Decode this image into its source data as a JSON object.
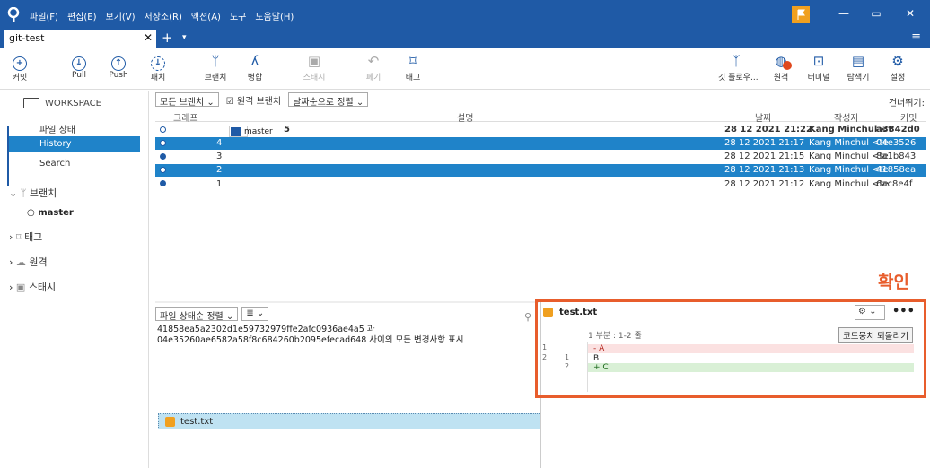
{
  "titlebar": {
    "menu": [
      "파일(F)",
      "편집(E)",
      "보기(V)",
      "저장소(R)",
      "액션(A)",
      "도구",
      "도움말(H)"
    ],
    "min": "—",
    "max": "▭",
    "close": "✕"
  },
  "tab": {
    "label": "git-test",
    "close": "✕",
    "plus": "+",
    "dropdown": "▾",
    "menu": "≡"
  },
  "toolbar": {
    "commit": "커밋",
    "pull": "Pull",
    "push": "Push",
    "patch": "패치",
    "branch": "브랜치",
    "merge": "병합",
    "stash": "스태시",
    "discard": "폐기",
    "tag": "태그",
    "gitflow": "깃 플로우...",
    "remote": "원격",
    "terminal": "터미널",
    "explorer": "탐색기",
    "settings": "설정"
  },
  "sidebar": {
    "workspace": "WORKSPACE",
    "items": [
      "파일 상태",
      "History",
      "Search"
    ],
    "branches": "브랜치",
    "master": "master",
    "tags": "태그",
    "remotes": "원격",
    "stash": "스태시"
  },
  "commits": {
    "filters": [
      "모든 브랜치 ⌄",
      "원격 브랜치",
      "날짜순으로 정렬 ⌄"
    ],
    "skip": "건너뛰기:",
    "headers": [
      "그래프",
      "설명",
      "날짜",
      "작성자",
      "커밋"
    ],
    "rows": [
      {
        "desc": "5",
        "date": "28 12 2021 21:22",
        "author": "Kang Minchul <t",
        "hash": "a3342d0"
      },
      {
        "desc": "4",
        "date": "28 12 2021 21:17",
        "author": "Kang Minchul <te",
        "hash": "04e3526"
      },
      {
        "desc": "3",
        "date": "28 12 2021 21:15",
        "author": "Kang Minchul <te",
        "hash": "8a1b843"
      },
      {
        "desc": "2",
        "date": "28 12 2021 21:13",
        "author": "Kang Minchul <te",
        "hash": "41858ea"
      },
      {
        "desc": "1",
        "date": "28 12 2021 21:12",
        "author": "Kang Minchul <te",
        "hash": "6ac8e4f"
      }
    ],
    "branch_tag": "master"
  },
  "files": {
    "sort": "파일 상태순 정렬 ⌄",
    "view": "≣ ⌄",
    "msg1": "41858ea5a2302d1e59732979ffe2afc0936ae4a5 과",
    "msg2": "04e35260ae6582a58f8c684260b2095efecad648 사이의 모든 변경사항 표시",
    "file": "test.txt"
  },
  "diff": {
    "file": "test.txt",
    "hunk": "1 부분 : 1-2 줄",
    "revert": "코드뭉치 되돌리기",
    "gear": "⚙ ⌄",
    "more": "•••",
    "lines": [
      "- A",
      "  B",
      "+ C"
    ],
    "confirm": "확인"
  }
}
